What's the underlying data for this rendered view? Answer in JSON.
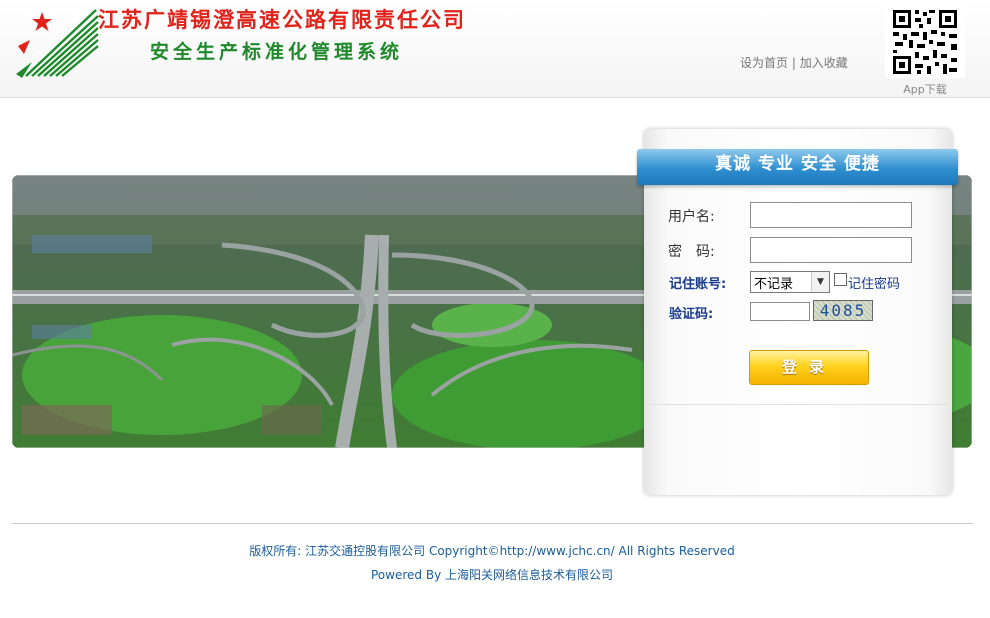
{
  "header": {
    "company_name": "江苏广靖锡澄高速公路有限责任公司",
    "system_name": "安全生产标准化管理系统",
    "link_homepage": "设为首页",
    "link_separator": "|",
    "link_favorite": "加入收藏",
    "app_download": "App下载",
    "logo_icon": "company-logo-icon",
    "qr_icon": "qr-code-icon"
  },
  "banner": {
    "image": "highway-interchange-aerial-photo"
  },
  "login": {
    "slogan": "真诚 专业 安全 便捷",
    "username_label": "用户名:",
    "username_value": "",
    "password_label": "密　码:",
    "password_value": "",
    "remember_label": "记住账号:",
    "remember_selected": "不记录",
    "remember_password_label": "记住密码",
    "captcha_label": "验证码:",
    "captcha_value": "",
    "captcha_code": "4085",
    "login_button": "登录"
  },
  "footer": {
    "copyright": "版权所有: 江苏交通控股有限公司 Copyright©http://www.jchc.cn/ All Rights Reserved",
    "powered_by": "Powered By 上海阳关网络信息技术有限公司"
  },
  "colors": {
    "company_red": "#e0231b",
    "system_green": "#1f8a2c",
    "ribbon_blue": "#2f8fd0",
    "label_blue": "#1a3a8c",
    "footer_blue": "#1a5d9a",
    "button_yellow": "#ffd21e"
  }
}
